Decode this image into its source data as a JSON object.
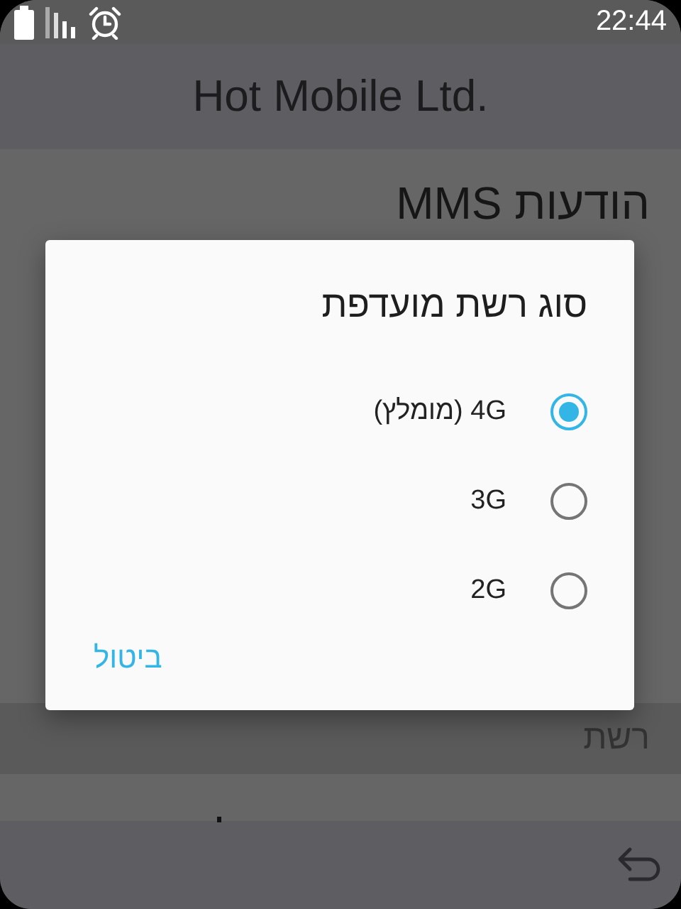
{
  "status_bar": {
    "time": "22:44"
  },
  "header": {
    "title": "Hot Mobile Ltd."
  },
  "background_items": [
    {
      "title": "הודעות MMS"
    }
  ],
  "section_header": "רשת",
  "dialog": {
    "title": "סוג רשת מועדפת",
    "options": [
      {
        "label": "4G (מומלץ)",
        "selected": true
      },
      {
        "label": "3G",
        "selected": false
      },
      {
        "label": "2G",
        "selected": false
      }
    ],
    "cancel": "ביטול"
  }
}
